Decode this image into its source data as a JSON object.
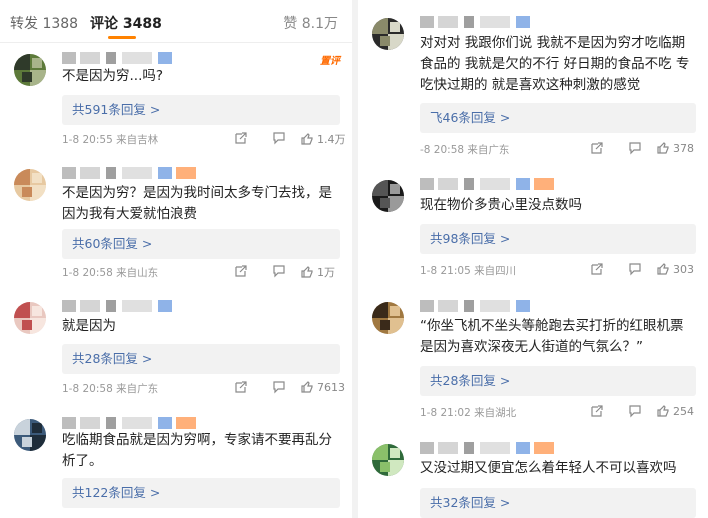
{
  "tabs": {
    "repost": "转发 1388",
    "comment": "评论 3488",
    "like": "赞 8.1万"
  },
  "left": [
    {
      "text_lines": [
        "不是因为穷...吗?"
      ],
      "reply": "共591条回复 >",
      "meta": "1-8 20:55 来自吉林",
      "likes": "1.4万",
      "badge": "置评",
      "avatar": [
        "#5d7a3a",
        "#2f3a2a",
        "#a8b48a"
      ]
    },
    {
      "text_lines": [
        "不是因为穷？是因为我时间太多专门去找，是",
        "因为我有大爱就怕浪费"
      ],
      "reply": "共60条回复 >",
      "meta": "1-8 20:58 来自山东",
      "likes": "1万",
      "avatar": [
        "#e7c9a1",
        "#c98a5a",
        "#f2e0c4"
      ]
    },
    {
      "text_lines": [
        "就是因为"
      ],
      "reply": "共28条回复 >",
      "meta": "1-8 20:58 来自广东",
      "likes": "7613",
      "avatar": [
        "#e9c8c0",
        "#c05050",
        "#f7e6df"
      ]
    },
    {
      "text_lines": [
        "吃临期食品就是因为穷啊，专家请不要再乱分",
        "析了。"
      ],
      "reply": "共122条回复 >",
      "avatar": [
        "#3c5a7a",
        "#c9d3dc",
        "#1f2d3a"
      ]
    }
  ],
  "right": [
    {
      "text_lines": [
        "对对对 我跟你们说 我就不是因为穷才吃临期",
        "食品的 我就是欠的不行 好日期的食品不吃 专",
        "吃快过期的 就是喜欢这种刺激的感觉"
      ],
      "reply": "飞46条回复 >",
      "meta": "-8 20:58 来自广东",
      "likes": "378",
      "avatar": [
        "#2a2a2a",
        "#8a8a6a",
        "#d8d8c8"
      ]
    },
    {
      "text_lines": [
        "现在物价多贵心里没点数吗"
      ],
      "reply": "共98条回复 >",
      "meta": "1-8 21:05 来自四川",
      "likes": "303",
      "avatar": [
        "#1a1a1a",
        "#555555",
        "#9a9a9a"
      ]
    },
    {
      "text_lines": [
        "“你坐飞机不坐头等舱跑去买打折的红眼机票",
        "是因为喜欢深夜无人街道的气氛么？”"
      ],
      "reply": "共28条回复 >",
      "meta": "1-8 21:02 来自湖北",
      "likes": "254",
      "avatar": [
        "#a07840",
        "#3a2a1a",
        "#e0c090"
      ]
    },
    {
      "text_lines": [
        "又没过期又便宜怎么着年轻人不可以喜欢吗"
      ],
      "reply": "共32条回复 >",
      "avatar": [
        "#2f6a3a",
        "#8ac06a",
        "#d0e8c0"
      ]
    }
  ],
  "icons": {
    "share": "share-icon",
    "comment": "comment-icon",
    "like": "thumb-up-icon"
  },
  "colors": {
    "accent": "#ff8200",
    "reply_link": "#4a6ea9",
    "reply_bg": "#f2f2f2",
    "meta": "#999999"
  }
}
